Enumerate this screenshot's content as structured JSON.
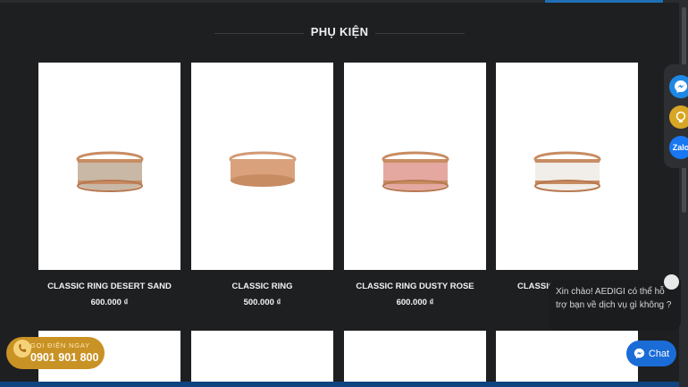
{
  "section": {
    "title": "PHỤ KIỆN"
  },
  "products": [
    {
      "name": "CLASSIC RING DESERT SAND",
      "price": "600.000 ₫",
      "band_color": "#c9b8a6"
    },
    {
      "name": "CLASSIC RING",
      "price": "500.000 ₫",
      "band_color": "#d9a27d"
    },
    {
      "name": "CLASSIC RING DUSTY ROSE",
      "price": "600.000 ₫",
      "band_color": "#e4a8a0"
    },
    {
      "name": "CLASSIC R",
      "price": "",
      "band_color": "#f1ede8"
    }
  ],
  "widgets": {
    "messenger_icon": "messenger-icon",
    "lightbulb_icon": "lightbulb-icon",
    "zalo_label": "Zalo",
    "chat_message": "Xin chào! AEDIGI có thể hỗ trợ bạn về dịch vụ gì không ?",
    "chat_button_label": "Chat",
    "call_label": "GỌI ĐIỆN NGAY",
    "call_phone": "0901 901 800"
  },
  "colors": {
    "background": "#1e1f21",
    "card": "#ffffff",
    "rose_gold": "#c88c63",
    "chat_blue": "#1a6cd6",
    "call_gold": "#c99224"
  }
}
